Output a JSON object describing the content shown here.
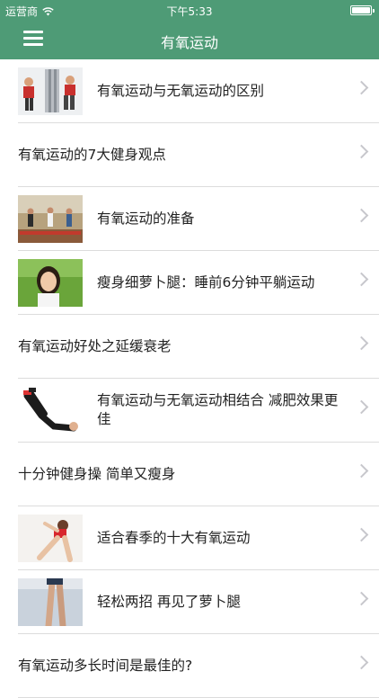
{
  "status": {
    "carrier": "运营商",
    "time": "下午5:33"
  },
  "nav": {
    "title": "有氧运动"
  },
  "items": [
    {
      "title": "有氧运动与无氧运动的区别",
      "thumb": "gym-equipment-photo"
    },
    {
      "title": "有氧运动的7大健身观点"
    },
    {
      "title": "有氧运动的准备",
      "thumb": "gym-class-photo"
    },
    {
      "title": "瘦身细萝卜腿：睡前6分钟平躺运动",
      "thumb": "woman-portrait-photo"
    },
    {
      "title": "有氧运动好处之延缓衰老"
    },
    {
      "title": "有氧运动与无氧运动相结合 减肥效果更佳",
      "thumb": "leg-exercise-photo"
    },
    {
      "title": "十分钟健身操 简单又瘦身"
    },
    {
      "title": "适合春季的十大有氧运动",
      "thumb": "stretching-woman-photo"
    },
    {
      "title": "轻松两招 再见了萝卜腿",
      "thumb": "legs-photo"
    },
    {
      "title": "有氧运动多长时间是最佳的?"
    }
  ]
}
